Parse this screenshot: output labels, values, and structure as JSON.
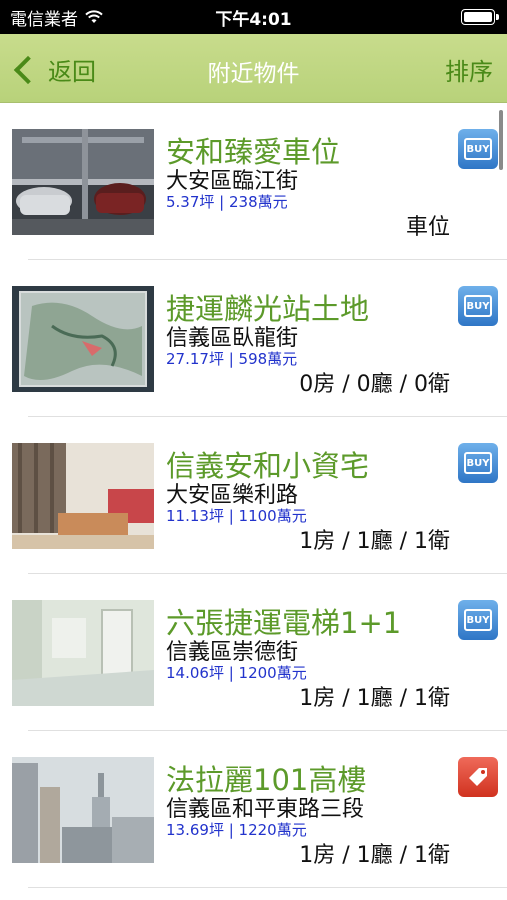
{
  "status_bar": {
    "carrier": "電信業者",
    "time": "下午4:01"
  },
  "nav": {
    "back_label": "返回",
    "title": "附近物件",
    "sort_label": "排序"
  },
  "listings": [
    {
      "title": "安和臻愛車位",
      "address": "大安區臨江街",
      "price": "5.37坪 | 238萬元",
      "layout": "車位",
      "badge": "buy",
      "badge_label": "BUY"
    },
    {
      "title": "捷運麟光站土地",
      "address": "信義區臥龍街",
      "price": "27.17坪 | 598萬元",
      "layout": "0房 / 0廳 / 0衛",
      "badge": "buy",
      "badge_label": "BUY"
    },
    {
      "title": "信義安和小資宅",
      "address": "大安區樂利路",
      "price": "11.13坪 | 1100萬元",
      "layout": "1房 / 1廳 / 1衛",
      "badge": "buy",
      "badge_label": "BUY"
    },
    {
      "title": "六張捷運電梯1+1",
      "address": "信義區崇德街",
      "price": "14.06坪 | 1200萬元",
      "layout": "1房 / 1廳 / 1衛",
      "badge": "buy",
      "badge_label": "BUY"
    },
    {
      "title": "法拉麗101高樓",
      "address": "信義區和平東路三段",
      "price": "13.69坪 | 1220萬元",
      "layout": "1房 / 1廳 / 1衛",
      "badge": "sale",
      "badge_label": ""
    }
  ]
}
